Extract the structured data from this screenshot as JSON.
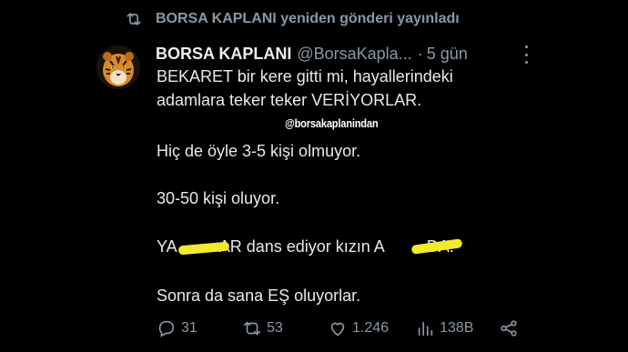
{
  "repost": {
    "text": "BORSA KAPLANI yeniden gönderi yayınladı",
    "icon": "repost-icon"
  },
  "tweet": {
    "author_name": "BORSA KAPLANI",
    "handle": "@BorsaKapla...",
    "separator": "·",
    "time": "5 gün",
    "avatar": "tiger-avatar",
    "lines": [
      "BEKARET bir kere gitti mi, hayallerindeki",
      "adamlara teker teker VERİYORLAR.",
      "Hiç de öyle 3-5 kişi olmuyor.",
      "30-50 kişi oluyor.",
      "YA",
      "AR dans ediyor kızın A",
      "DA.",
      "Sonra da sana EŞ oluyorlar."
    ],
    "watermark": "@borsakaplanindan",
    "stats": {
      "replies": "31",
      "reposts": "53",
      "likes": "1.246",
      "views": "138B"
    }
  },
  "colors": {
    "background": "#000000",
    "text": "#e7e9ea",
    "muted": "#8b98a5",
    "highlighter": "#f2ea2c"
  }
}
